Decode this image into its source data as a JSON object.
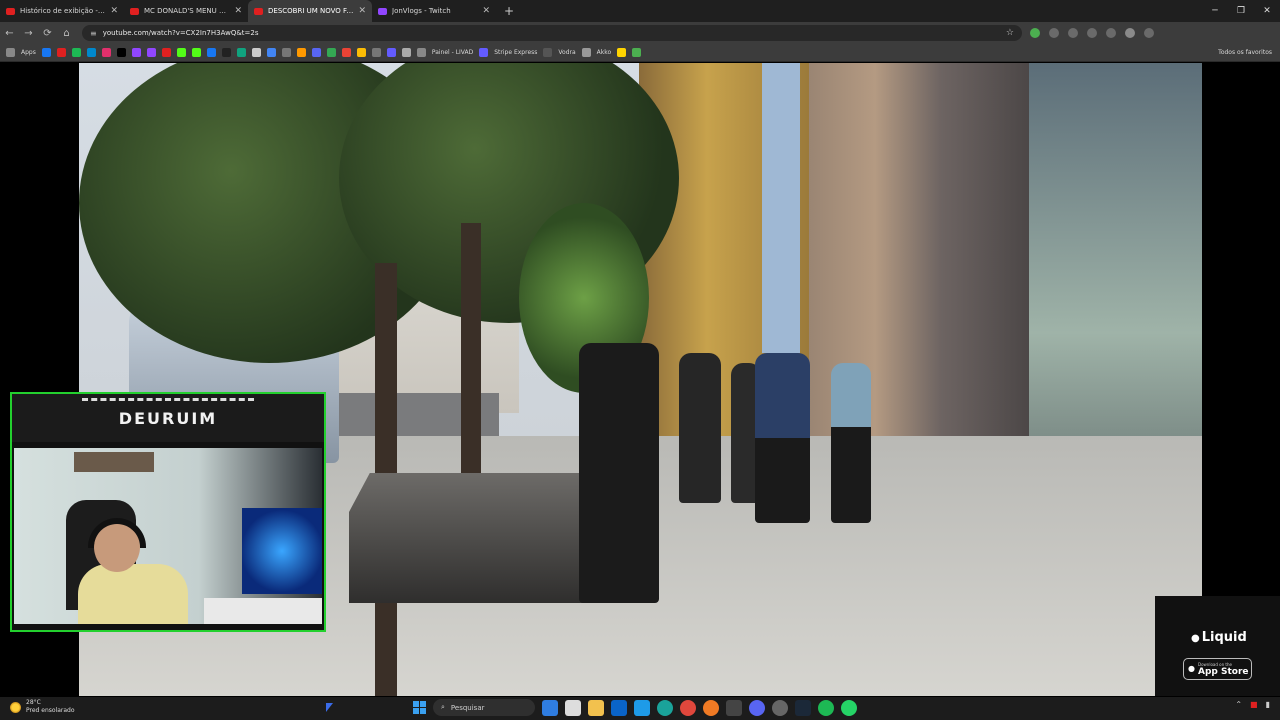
{
  "browser": {
    "tabs": [
      {
        "title": "Histórico de exibição - YouTube",
        "color": "#e02020"
      },
      {
        "title": "MC DONALD'S MENU GLOBAL",
        "color": "#e02020"
      },
      {
        "title": "DESCOBRI UM NOVO FAST",
        "color": "#e02020",
        "active": true
      },
      {
        "title": "JonVlogs - Twitch",
        "color": "#9146ff"
      }
    ],
    "new_tab": "+",
    "url": "youtube.com/watch?v=CX2In7H3AwQ&t=2s",
    "bookmarks": {
      "apps_label": "Apps",
      "items": [
        "Painel - LIVAD",
        "Stripe Express",
        "Vodra",
        "Akko"
      ],
      "right_label": "Todos os favoritos"
    }
  },
  "stream": {
    "overlay_name": "DEURUIM"
  },
  "ad": {
    "brand": "Liquid",
    "store_small": "Download on the",
    "store_big": "App Store"
  },
  "taskbar": {
    "temperature": "28°C",
    "weather_text": "Pred ensolarado",
    "search_label": "Pesquisar"
  }
}
